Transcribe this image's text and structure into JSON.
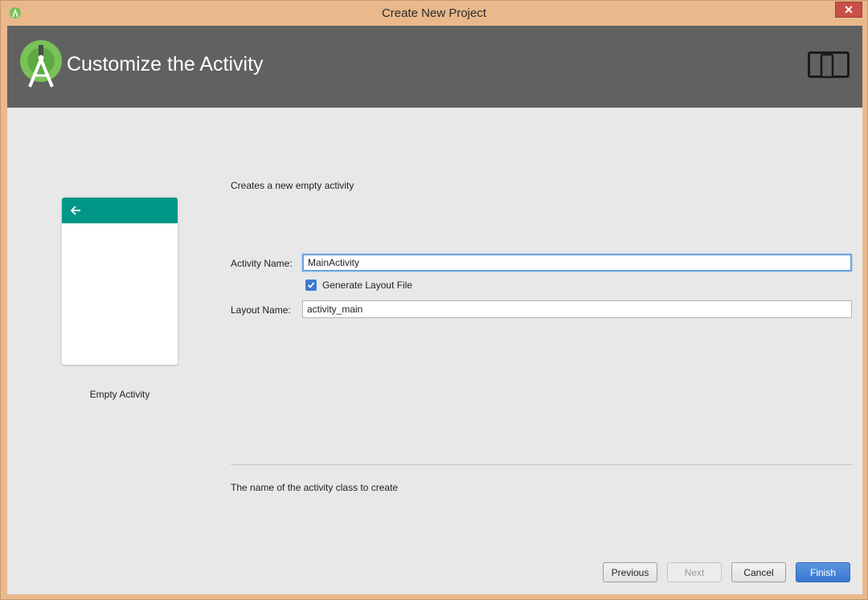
{
  "window": {
    "title": "Create New Project",
    "close_glyph": "✕"
  },
  "header": {
    "heading": "Customize the Activity",
    "logo_icon": "android-studio-logo-icon",
    "device_icon": "phone-tablet-icon"
  },
  "template": {
    "name": "Empty Activity",
    "appbar_color": "#009688"
  },
  "form": {
    "description": "Creates a new empty activity",
    "activity_name_label": "Activity Name:",
    "activity_name_value": "MainActivity",
    "generate_layout_label": "Generate Layout File",
    "generate_layout_checked": true,
    "layout_name_label": "Layout Name:",
    "layout_name_value": "activity_main",
    "hint": "The name of the activity class to create"
  },
  "buttons": {
    "previous": "Previous",
    "next": "Next",
    "cancel": "Cancel",
    "finish": "Finish"
  },
  "colors": {
    "header_bg": "#616161",
    "frame": "#e9b98c",
    "primary_button": "#3b78d0"
  }
}
